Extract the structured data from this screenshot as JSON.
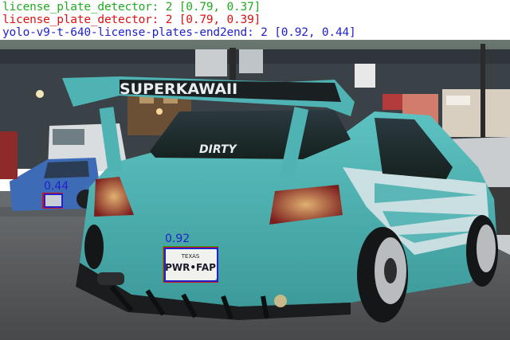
{
  "legend": {
    "lines": [
      {
        "model": "license_plate_detector",
        "count": "2",
        "values": "[0.79, 0.37]",
        "color": "#22aa22"
      },
      {
        "model": "license_plate_detector",
        "count": "2",
        "values": "[0.79, 0.39]",
        "color": "#dd1111"
      },
      {
        "model": "yolo-v9-t-640-license-plates-end2end",
        "count": "2",
        "values": "[0.92, 0.44]",
        "color": "#2222cc"
      }
    ],
    "text": [
      "license_plate_detector: 2 [0.79, 0.37]",
      "license_plate_detector: 2 [0.79, 0.39]",
      "yolo-v9-t-640-license-plates-end2end: 2 [0.92, 0.44]"
    ]
  },
  "photo": {
    "spoiler_text": "SUPERKAWAII",
    "windshield_sticker": "DIRTY",
    "plate_state": "TEXAS",
    "plate_number": "PWR•FAP"
  },
  "detections": {
    "main_plate_score": "0.92",
    "left_plate_score": "0.44"
  },
  "colors": {
    "green": "#22aa22",
    "red": "#dd1111",
    "blue": "#2222cc",
    "car_body": "#4fb3b3"
  }
}
